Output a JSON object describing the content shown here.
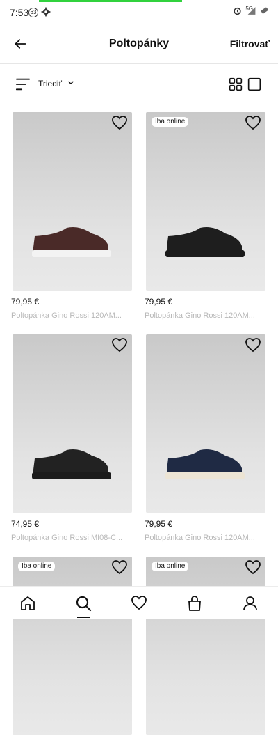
{
  "status_bar": {
    "time": "7:53",
    "notification_badge": "63",
    "network": "5G"
  },
  "header": {
    "title": "Poltopánky",
    "filter_label": "Filtrovať"
  },
  "toolbar": {
    "sort_label": "Triediť"
  },
  "products": [
    {
      "price": "79,95 €",
      "name": "Poltopánka Gino Rossi 120AM...",
      "tag": "",
      "shoe_color": "#4a2a28",
      "sole_color": "#f3f3f3"
    },
    {
      "price": "79,95 €",
      "name": "Poltopánka Gino Rossi 120AM...",
      "tag": "Iba online",
      "shoe_color": "#1e1e1e",
      "sole_color": "#1a1a1a"
    },
    {
      "price": "74,95 €",
      "name": "Poltopánka Gino Rossi MI08-C...",
      "tag": "",
      "shoe_color": "#222222",
      "sole_color": "#1c1c1c"
    },
    {
      "price": "79,95 €",
      "name": "Poltopánka Gino Rossi 120AM...",
      "tag": "",
      "shoe_color": "#1f2a44",
      "sole_color": "#ece4d4"
    },
    {
      "price": "",
      "name": "",
      "tag": "Iba online",
      "shoe_color": "",
      "sole_color": ""
    },
    {
      "price": "",
      "name": "",
      "tag": "Iba online",
      "shoe_color": "",
      "sole_color": ""
    }
  ],
  "bottom_nav": {
    "items": [
      "home-icon",
      "search-icon",
      "heart-icon",
      "bag-icon",
      "profile-icon"
    ],
    "active": "search-icon"
  },
  "colors": {
    "accent": "#111111",
    "progress": "#31d23e",
    "muted_text": "#b8b8b8"
  }
}
